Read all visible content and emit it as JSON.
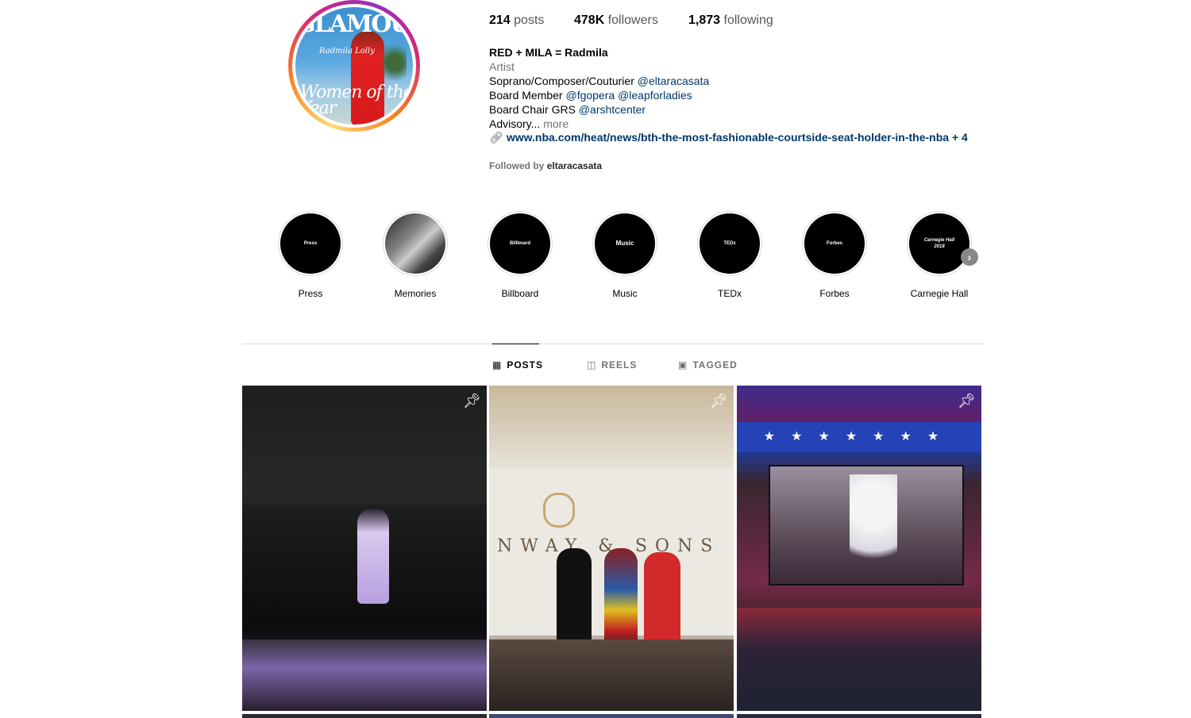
{
  "profile": {
    "avatar_cover": {
      "title": "GLAMOUR",
      "name": "Radmila Lolly",
      "headline": "Women of the Year"
    },
    "stats": {
      "posts_count": "214",
      "posts_label": "posts",
      "followers_count": "478K",
      "followers_label": "followers",
      "following_count": "1,873",
      "following_label": "following"
    },
    "name": "RED + MILA = Radmila",
    "category": "Artist",
    "bio": {
      "line1_text": "Soprano/Composer/Couturier",
      "line1_mention": "@eltaracasata",
      "line2_text": "Board Member",
      "line2_mention_a": "@fgopera",
      "line2_mention_b": "@leapforladies",
      "line3_text": "Board Chair GRS",
      "line3_mention": "@arshtcenter",
      "line4_text": "Advisory...",
      "line4_more": "more"
    },
    "link": {
      "icon": "link-icon",
      "url": "www.nba.com/heat/news/bth-the-most-fashionable-courtside-seat-holder-in-the-nba",
      "extra": "+ 4"
    },
    "followed_by_label": "Followed by",
    "followed_by_user": "eltaracasata"
  },
  "highlights": [
    {
      "label": "Press",
      "cover_text": "Press"
    },
    {
      "label": "Memories",
      "cover_text": ""
    },
    {
      "label": "Billboard",
      "cover_text": "Billboard"
    },
    {
      "label": "Music",
      "cover_text": "Music"
    },
    {
      "label": "TEDx",
      "cover_text": "TEDx"
    },
    {
      "label": "Forbes",
      "cover_text": "Forbes"
    },
    {
      "label": "Carnegie Hall",
      "cover_text": "Carnegie Hall 2018"
    }
  ],
  "highlights_next_icon": "chevron-right-icon",
  "tabs": [
    {
      "label": "POSTS",
      "icon": "grid-icon",
      "active": true
    },
    {
      "label": "REELS",
      "icon": "reels-icon",
      "active": false
    },
    {
      "label": "TAGGED",
      "icon": "tagged-icon",
      "active": false
    }
  ],
  "posts": [
    {
      "pinned": true,
      "pin_icon": "pin-icon"
    },
    {
      "pinned": true,
      "pin_icon": "pin-icon",
      "sign_text": "NWAY & SONS"
    },
    {
      "pinned": true,
      "pin_icon": "pin-icon"
    }
  ],
  "colors": {
    "link": "#00376b",
    "muted": "#737373",
    "divider": "#dbdbdb"
  }
}
